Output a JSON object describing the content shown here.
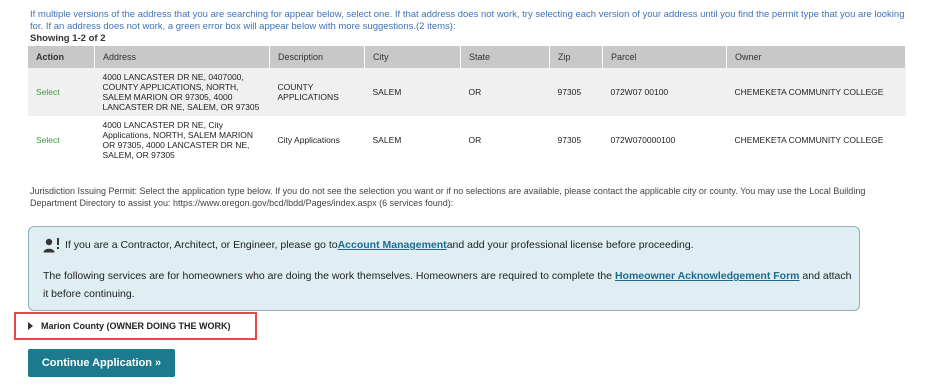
{
  "intro_text": "If multiple versions of the address that you are searching for appear below, select one. If that address does not work, try selecting each version of your address until you find the permit type that you are looking for. If an address does not work, a green error box will appear below with more suggestions.(2 items):",
  "showing_text": "Showing 1-2 of 2",
  "table": {
    "headers": [
      "Action",
      "Address",
      "Description",
      "City",
      "State",
      "Zip",
      "Parcel",
      "Owner"
    ],
    "rows": [
      {
        "action": "Select",
        "address": "4000 LANCASTER DR NE, 0407000, COUNTY APPLICATIONS, NORTH, SALEM MARION OR 97305, 4000 LANCASTER DR NE, SALEM, OR 97305",
        "description": "COUNTY APPLICATIONS",
        "city": "SALEM",
        "state": "OR",
        "zip": "97305",
        "parcel": "072W07 00100",
        "owner": "CHEMEKETA COMMUNITY COLLEGE"
      },
      {
        "action": "Select",
        "address": "4000 LANCASTER DR NE, City Applications, NORTH, SALEM MARION OR 97305, 4000 LANCASTER DR NE, SALEM, OR 97305",
        "description": "City Applications",
        "city": "SALEM",
        "state": "OR",
        "zip": "97305",
        "parcel": "072W070000100",
        "owner": "CHEMEKETA COMMUNITY COLLEGE"
      }
    ]
  },
  "jurisdiction_text": "Jurisdiction Issuing Permit: Select the application type below. If you do not see the selection you want or if no selections are available, please contact the applicable city or county. You may use the Local Building Department Directory to assist you: https://www.oregon.gov/bcd/lbdd/Pages/index.aspx (6 services found):",
  "notice": {
    "line1_prefix": "If you are a Contractor, Architect, or Engineer, please go to ",
    "line1_link": "Account Management",
    "line1_suffix": " and add your professional license before proceeding.",
    "line2_prefix": "The following services are for homeowners who are doing the work themselves. Homeowners are required to complete the ",
    "line2_link": "Homeowner Acknowledgement Form",
    "line2_suffix": " and attach it before continuing.",
    "icon": "person-info-icon"
  },
  "county_expander": "Marion County (OWNER DOING THE WORK)",
  "continue_button": "Continue Application »",
  "colors": {
    "link_blue": "#3f73b8",
    "select_green": "#3c9a3c",
    "notice_bg": "#deeef3",
    "highlight_red": "#e8474a",
    "button_teal": "#1c7a8f"
  }
}
